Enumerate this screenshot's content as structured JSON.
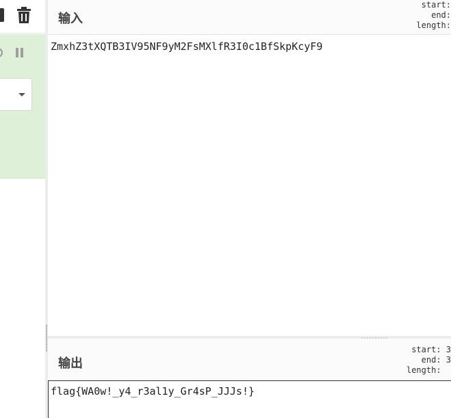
{
  "colors": {
    "recipe_background": "#dff0d8",
    "header_background": "#fafafa",
    "icon_color": "#333333"
  },
  "icons": {
    "save": "save-icon",
    "trash": "trash-icon",
    "disable": "disable-icon",
    "pause": "pause-icon",
    "dropdown": "chevron-down-icon"
  },
  "input": {
    "title": "输入",
    "stats": {
      "start": "start:",
      "end": "end:",
      "length": "length:"
    },
    "value": "ZmxhZ3tXQTB3IV95NF9yM2FsMXlfR3I0c1BfSkpKcyF9"
  },
  "output": {
    "title": "输出",
    "stats": {
      "start": "start: 3",
      "end": "end: 3",
      "length": "length:  "
    },
    "value": "flag{WA0w!_y4_r3al1y_Gr4sP_JJJs!}"
  }
}
